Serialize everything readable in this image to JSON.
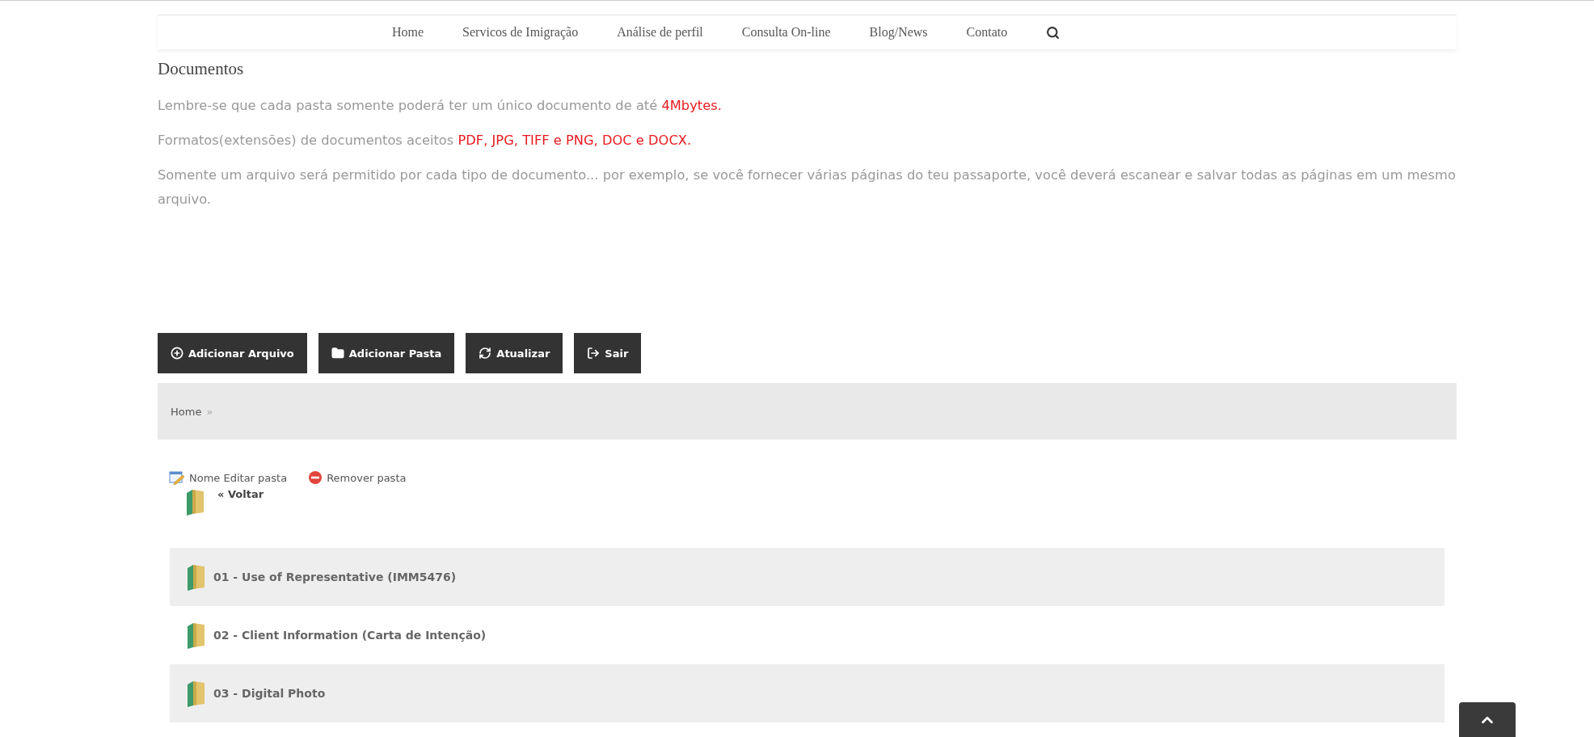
{
  "nav": {
    "items": [
      "Home",
      "Servicos de Imigração",
      "Análise de perfil",
      "Consulta On-line",
      "Blog/News",
      "Contato"
    ]
  },
  "title": "Documentos",
  "notes": [
    {
      "text": "Lembre-se que cada pasta somente poderá ter um único documento de até ",
      "highlight": "4Mbytes."
    },
    {
      "text": "Formatos(extensões) de documentos aceitos ",
      "highlight": "PDF, JPG, TIFF e PNG, DOC e DOCX."
    },
    {
      "text": "Somente um arquivo será permitido por cada tipo de documento... por exemplo, se você fornecer várias páginas do teu passaporte, você deverá escanear e salvar todas as páginas em um mesmo arquivo."
    }
  ],
  "toolbar": [
    {
      "kind": "add-file",
      "label": "Adicionar Arquivo"
    },
    {
      "kind": "add-folder",
      "label": "Adicionar Pasta"
    },
    {
      "kind": "refresh",
      "label": "Atualizar"
    },
    {
      "kind": "exit",
      "label": "Sair"
    }
  ],
  "breadcrumb": {
    "label": "Home",
    "separator": "»"
  },
  "folder_actions": [
    {
      "kind": "edit",
      "label": "Nome Editar pasta"
    },
    {
      "kind": "remove",
      "label": "Remover pasta"
    }
  ],
  "back": "« Voltar",
  "folders": [
    "01 - Use of Representative (IMM5476)",
    "02 - Client Information (Carta de Intenção)",
    "03 - Digital Photo"
  ]
}
